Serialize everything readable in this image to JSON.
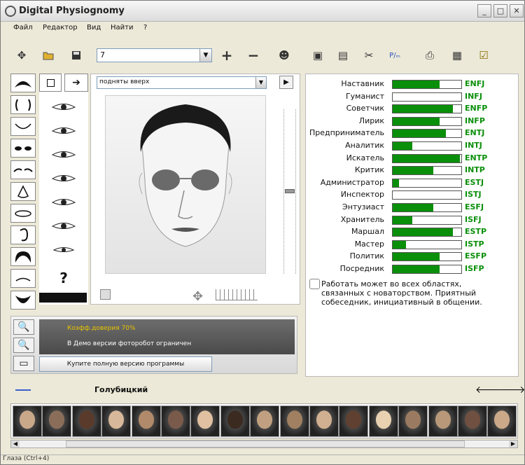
{
  "window": {
    "title": "Digital Physiognomy",
    "buttons": [
      "_",
      "□",
      "✕"
    ]
  },
  "menu": [
    "Файл",
    "Редактор",
    "Вид",
    "Найти",
    "?"
  ],
  "toolbar": {
    "combo_value": "7",
    "icons": [
      "move-icon",
      "open-icon",
      "save-icon",
      "plus-icon",
      "minus-icon",
      "face-icon",
      "document-icon",
      "notes-icon",
      "tools-icon",
      "text-icon",
      "print-icon",
      "export-icon",
      "check-icon"
    ]
  },
  "face_panel": {
    "feature_select": "подняты вверх",
    "hint": "?"
  },
  "info": {
    "line1": "Коэфф.доверия  70%",
    "line2": "В Демо версии фоторобот ограничен",
    "buy_button": "Купите полную версию программы"
  },
  "types": [
    {
      "label": "Наставник",
      "code": "ENFJ",
      "value": 0.68
    },
    {
      "label": "Гуманист",
      "code": "INFJ",
      "value": 0.0
    },
    {
      "label": "Советчик",
      "code": "ENFP",
      "value": 0.88
    },
    {
      "label": "Лирик",
      "code": "INFP",
      "value": 0.68
    },
    {
      "label": "Предприниматель",
      "code": "ENTJ",
      "value": 0.78
    },
    {
      "label": "Аналитик",
      "code": "INTJ",
      "value": 0.29
    },
    {
      "label": "Искатель",
      "code": "ENTP",
      "value": 0.98
    },
    {
      "label": "Критик",
      "code": "INTP",
      "value": 0.59
    },
    {
      "label": "Администратор",
      "code": "ESTJ",
      "value": 0.09
    },
    {
      "label": "Инспектор",
      "code": "ISTJ",
      "value": 0.0
    },
    {
      "label": "Энтузиаст",
      "code": "ESFJ",
      "value": 0.59
    },
    {
      "label": "Хранитель",
      "code": "ISFJ",
      "value": 0.29
    },
    {
      "label": "Маршал",
      "code": "ESTP",
      "value": 0.88
    },
    {
      "label": "Мастер",
      "code": "ISTP",
      "value": 0.19
    },
    {
      "label": "Политик",
      "code": "ESFP",
      "value": 0.68
    },
    {
      "label": "Посредник",
      "code": "ISFP",
      "value": 0.68
    }
  ],
  "description": "Работать может во всех областях, связанных с новаторством. Приятный собеседник, инициативный в общении.",
  "gallery": {
    "name": "Голубицкий",
    "thumb_count": 17
  },
  "status": "Глаза (Ctrl+4)",
  "colors": {
    "bar_green": "#0a8f0a",
    "code_green": "#0a8f0a"
  }
}
